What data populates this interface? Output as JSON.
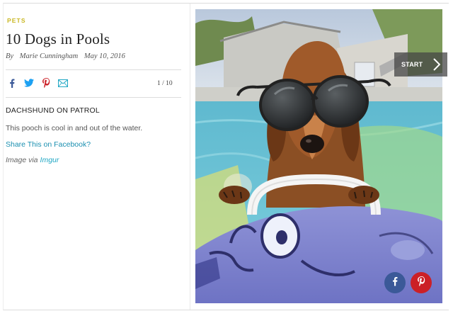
{
  "article": {
    "category": "PETS",
    "title": "10 Dogs in Pools",
    "byline_prefix": "By",
    "author": "Marie Cunningham",
    "date": "May 10, 2016"
  },
  "share_bar": {
    "icons": [
      "facebook-icon",
      "twitter-icon",
      "pinterest-icon",
      "email-icon"
    ],
    "counter": "1 / 10"
  },
  "slide": {
    "title": "DACHSHUND ON PATROL",
    "description": "This pooch is cool in and out of the water.",
    "share_link": "Share This on Facebook?",
    "credit_prefix": "Image via",
    "credit_source": "Imgur"
  },
  "gallery": {
    "start_label": "START"
  },
  "colors": {
    "category": "#c9b722",
    "link": "#1a8fb0",
    "facebook": "#3b5998",
    "pinterest": "#cb2027",
    "twitter": "#1da1f2"
  }
}
